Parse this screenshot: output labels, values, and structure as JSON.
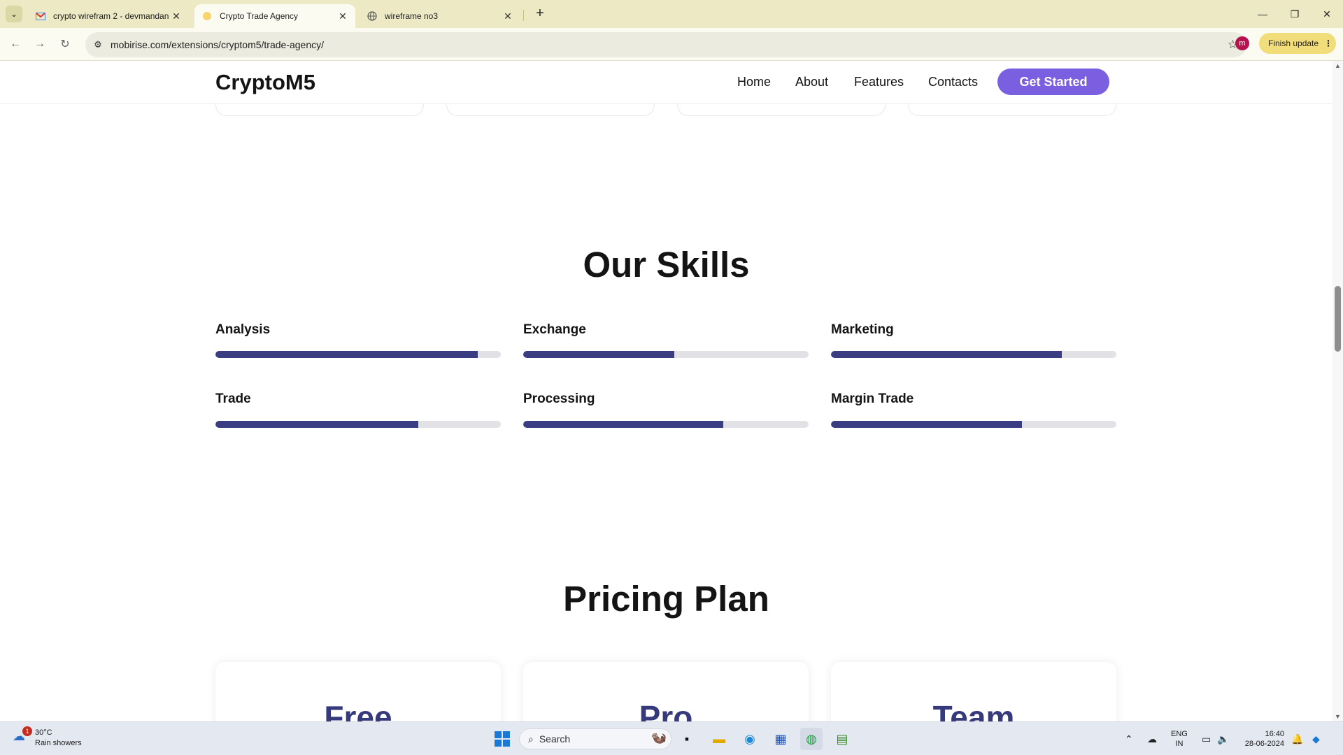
{
  "browser": {
    "tabs": [
      {
        "title": "crypto wirefram 2 - devmandan",
        "icon": "gmail-icon"
      },
      {
        "title": "Crypto Trade Agency",
        "icon": "site-favicon"
      },
      {
        "title": "wireframe no3",
        "icon": "globe-icon"
      }
    ],
    "url": "mobirise.com/extensions/cryptom5/trade-agency/",
    "profile_initial": "m",
    "finish_update_label": "Finish update"
  },
  "site": {
    "brand": "CryptoM5",
    "nav": [
      "Home",
      "About",
      "Features",
      "Contacts"
    ],
    "cta_label": "Get Started",
    "accent_color": "#7a5fe0",
    "bar_color": "#3b3d82"
  },
  "skills": {
    "title": "Our Skills",
    "items": [
      {
        "label": "Analysis",
        "percent": 92
      },
      {
        "label": "Exchange",
        "percent": 53
      },
      {
        "label": "Marketing",
        "percent": 81
      },
      {
        "label": "Trade",
        "percent": 71
      },
      {
        "label": "Processing",
        "percent": 70
      },
      {
        "label": "Margin Trade",
        "percent": 67
      }
    ]
  },
  "pricing": {
    "title": "Pricing Plan",
    "plans": [
      "Free",
      "Pro",
      "Team"
    ]
  },
  "taskbar": {
    "weather_temp": "30°C",
    "weather_desc": "Rain showers",
    "weather_badge": "1",
    "search_placeholder": "Search",
    "lang_line1": "ENG",
    "lang_line2": "IN",
    "time": "16:40",
    "date": "28-06-2024"
  }
}
